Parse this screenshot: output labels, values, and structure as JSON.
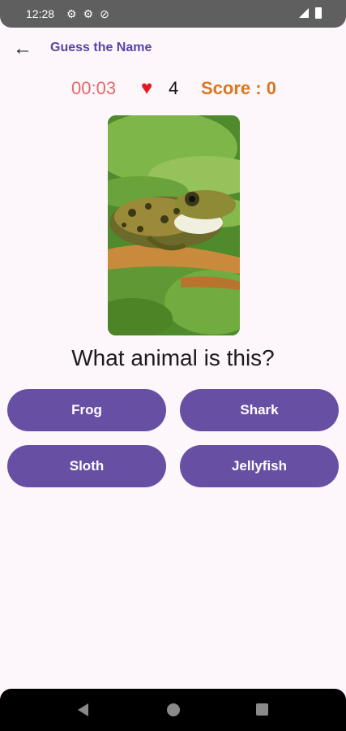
{
  "status_bar": {
    "time": "12:28",
    "icons": [
      "gear-icon",
      "gear-icon",
      "no-data-icon"
    ],
    "right_icons": [
      "signal-icon",
      "battery-icon"
    ]
  },
  "app_bar": {
    "back_icon": "arrow-back-icon",
    "title": "Guess the Name"
  },
  "stats": {
    "timer": "00:03",
    "lives": "4",
    "score": "Score : 0"
  },
  "image": {
    "subject": "frog on lily pads"
  },
  "question": "What animal is this?",
  "answers": [
    "Frog",
    "Shark",
    "Sloth",
    "Jellyfish"
  ],
  "colors": {
    "primary": "#6750a4",
    "title": "#5846a6",
    "timer": "#e26a6a",
    "heart": "#e11b22",
    "score": "#d9781e",
    "background": "#fdf6fb"
  }
}
